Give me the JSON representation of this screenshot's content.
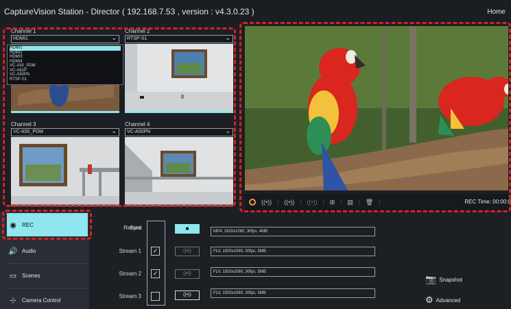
{
  "title": "CaptureVision Station - Director ( 192.168.7.53 , version : v4.3.0.23 )",
  "home_label": "Home",
  "channels": [
    {
      "label": "Channel 1",
      "selected": "HDMI1"
    },
    {
      "label": "Channel 2",
      "selected": "RTSP-S1"
    },
    {
      "label": "Channel 3",
      "selected": "VC-A50_PDM"
    },
    {
      "label": "Channel 4",
      "selected": "VC-A50PN"
    }
  ],
  "dropdown_options": [
    "HDMI1",
    "HDMI2",
    "HDMI3",
    "HDMI4",
    "VC-A50_PDM",
    "VC-A61P",
    "VC-A50PN",
    "RTSP-S1"
  ],
  "dropdown_highlight_index": 0,
  "control_bar": {
    "icons": [
      "record-icon",
      "stream-1-icon",
      "stream-2-icon",
      "stream-3-icon",
      "layout-icon",
      "storage-icon",
      "delete-icon"
    ],
    "rec_time_label": "REC Time: 00:00:0"
  },
  "nav": [
    {
      "label": "REC",
      "icon": "record-icon",
      "active": true
    },
    {
      "label": "Audio",
      "icon": "speaker-icon",
      "active": false
    },
    {
      "label": "Scenes",
      "icon": "scenes-icon",
      "active": false
    },
    {
      "label": "Camera Control",
      "icon": "camera-control-icon",
      "active": false
    }
  ],
  "streams": {
    "record_label": "Record",
    "sync_label": "Sync",
    "rows": [
      {
        "label": "Record",
        "sync_checked": null,
        "button": "■",
        "info": "MP4, 1920x1080, 30fps, 4MB"
      },
      {
        "label": "Stream 1",
        "sync_checked": true,
        "button": "((•))",
        "info": "FLV, 1920x1080, 30fps, 3MB"
      },
      {
        "label": "Stream 2",
        "sync_checked": true,
        "button": "((•))",
        "info": "FLV, 1920x1080, 30fps, 3MB"
      },
      {
        "label": "Stream 3",
        "sync_checked": false,
        "button": "((•))",
        "info": "FLV, 1920x1080, 30fps, 3MB"
      }
    ]
  },
  "side_actions": [
    {
      "label": "Snapshot",
      "icon": "camera-icon"
    },
    {
      "label": "Advanced",
      "icon": "gear-icon"
    }
  ],
  "colors": {
    "accent": "#8fe6ee",
    "highlight_dash": "#d42323",
    "background": "#1c1f24"
  }
}
